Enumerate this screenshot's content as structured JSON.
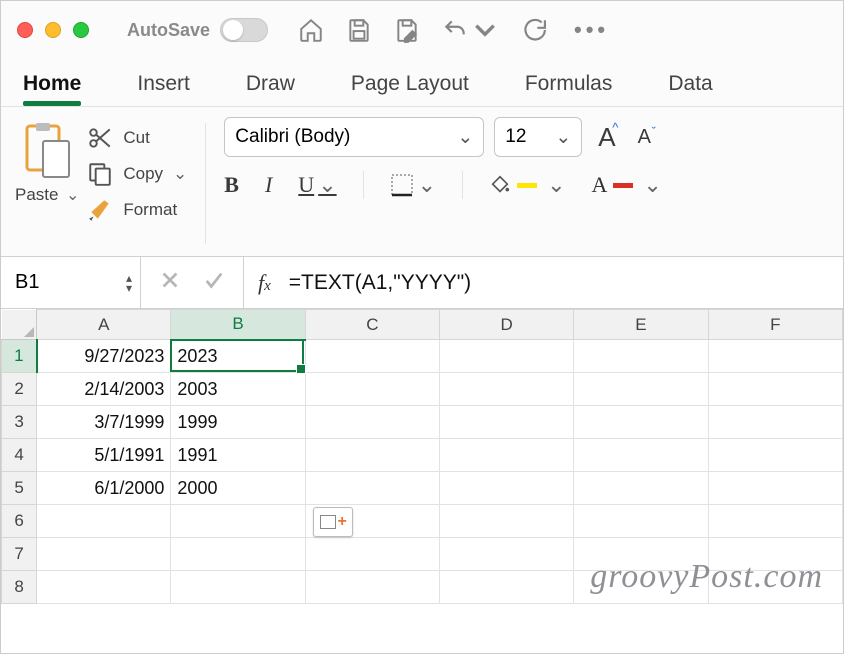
{
  "titlebar": {
    "autosave_label": "AutoSave"
  },
  "tabs": [
    "Home",
    "Insert",
    "Draw",
    "Page Layout",
    "Formulas",
    "Data"
  ],
  "active_tab": 0,
  "clipboard": {
    "paste_label": "Paste",
    "cut_label": "Cut",
    "copy_label": "Copy",
    "format_label": "Format"
  },
  "font": {
    "name": "Calibri (Body)",
    "size": "12"
  },
  "namebox": "B1",
  "formula": "=TEXT(A1,\"YYYY\")",
  "columns": [
    "A",
    "B",
    "C",
    "D",
    "E",
    "F"
  ],
  "selected_col_index": 1,
  "selected_row_index": 0,
  "rows": [
    {
      "n": "1",
      "A": "9/27/2023",
      "B": "2023"
    },
    {
      "n": "2",
      "A": "2/14/2003",
      "B": "2003"
    },
    {
      "n": "3",
      "A": "3/7/1999",
      "B": "1999"
    },
    {
      "n": "4",
      "A": "5/1/1991",
      "B": "1991"
    },
    {
      "n": "5",
      "A": "6/1/2000",
      "B": "2000"
    },
    {
      "n": "6",
      "A": "",
      "B": ""
    },
    {
      "n": "7",
      "A": "",
      "B": ""
    },
    {
      "n": "8",
      "A": "",
      "B": ""
    }
  ],
  "watermark": "groovyPost.com"
}
